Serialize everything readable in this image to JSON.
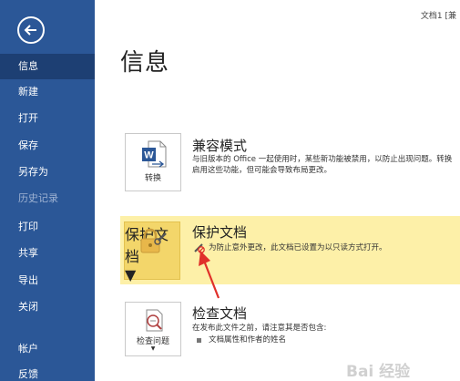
{
  "sidebar": {
    "back_label": "",
    "items": [
      {
        "label": "信息"
      },
      {
        "label": "新建"
      },
      {
        "label": "打开"
      },
      {
        "label": "保存"
      },
      {
        "label": "另存为"
      },
      {
        "label": "历史记录"
      },
      {
        "label": "打印"
      },
      {
        "label": "共享"
      },
      {
        "label": "导出"
      },
      {
        "label": "关闭"
      },
      {
        "label": "帐户"
      },
      {
        "label": "反馈"
      }
    ]
  },
  "header": {
    "doc_title": "文档1 [兼"
  },
  "main": {
    "page_title": "信息",
    "compat": {
      "button_label": "转换",
      "title": "兼容模式",
      "desc_line1": "与旧版本的 Office 一起使用时，某些新功能被禁用，以防止出现问题。转换",
      "desc_line2": "启用这些功能，但可能会导致布局更改。"
    },
    "protect": {
      "button_label": "保护文档",
      "title": "保护文档",
      "desc": "为防止意外更改，此文档已设置为以只读方式打开。"
    },
    "inspect": {
      "button_label": "检查问题",
      "title": "检查文档",
      "desc": "在发布此文件之前，请注意其是否包含:",
      "bullet": "文档属性和作者的姓名"
    }
  },
  "watermark": "Bai 经验",
  "colors": {
    "sidebar": "#2b5797",
    "sidebar_active": "#1d3f73",
    "highlight": "#fdf0a8",
    "arrow": "#e0302a"
  }
}
